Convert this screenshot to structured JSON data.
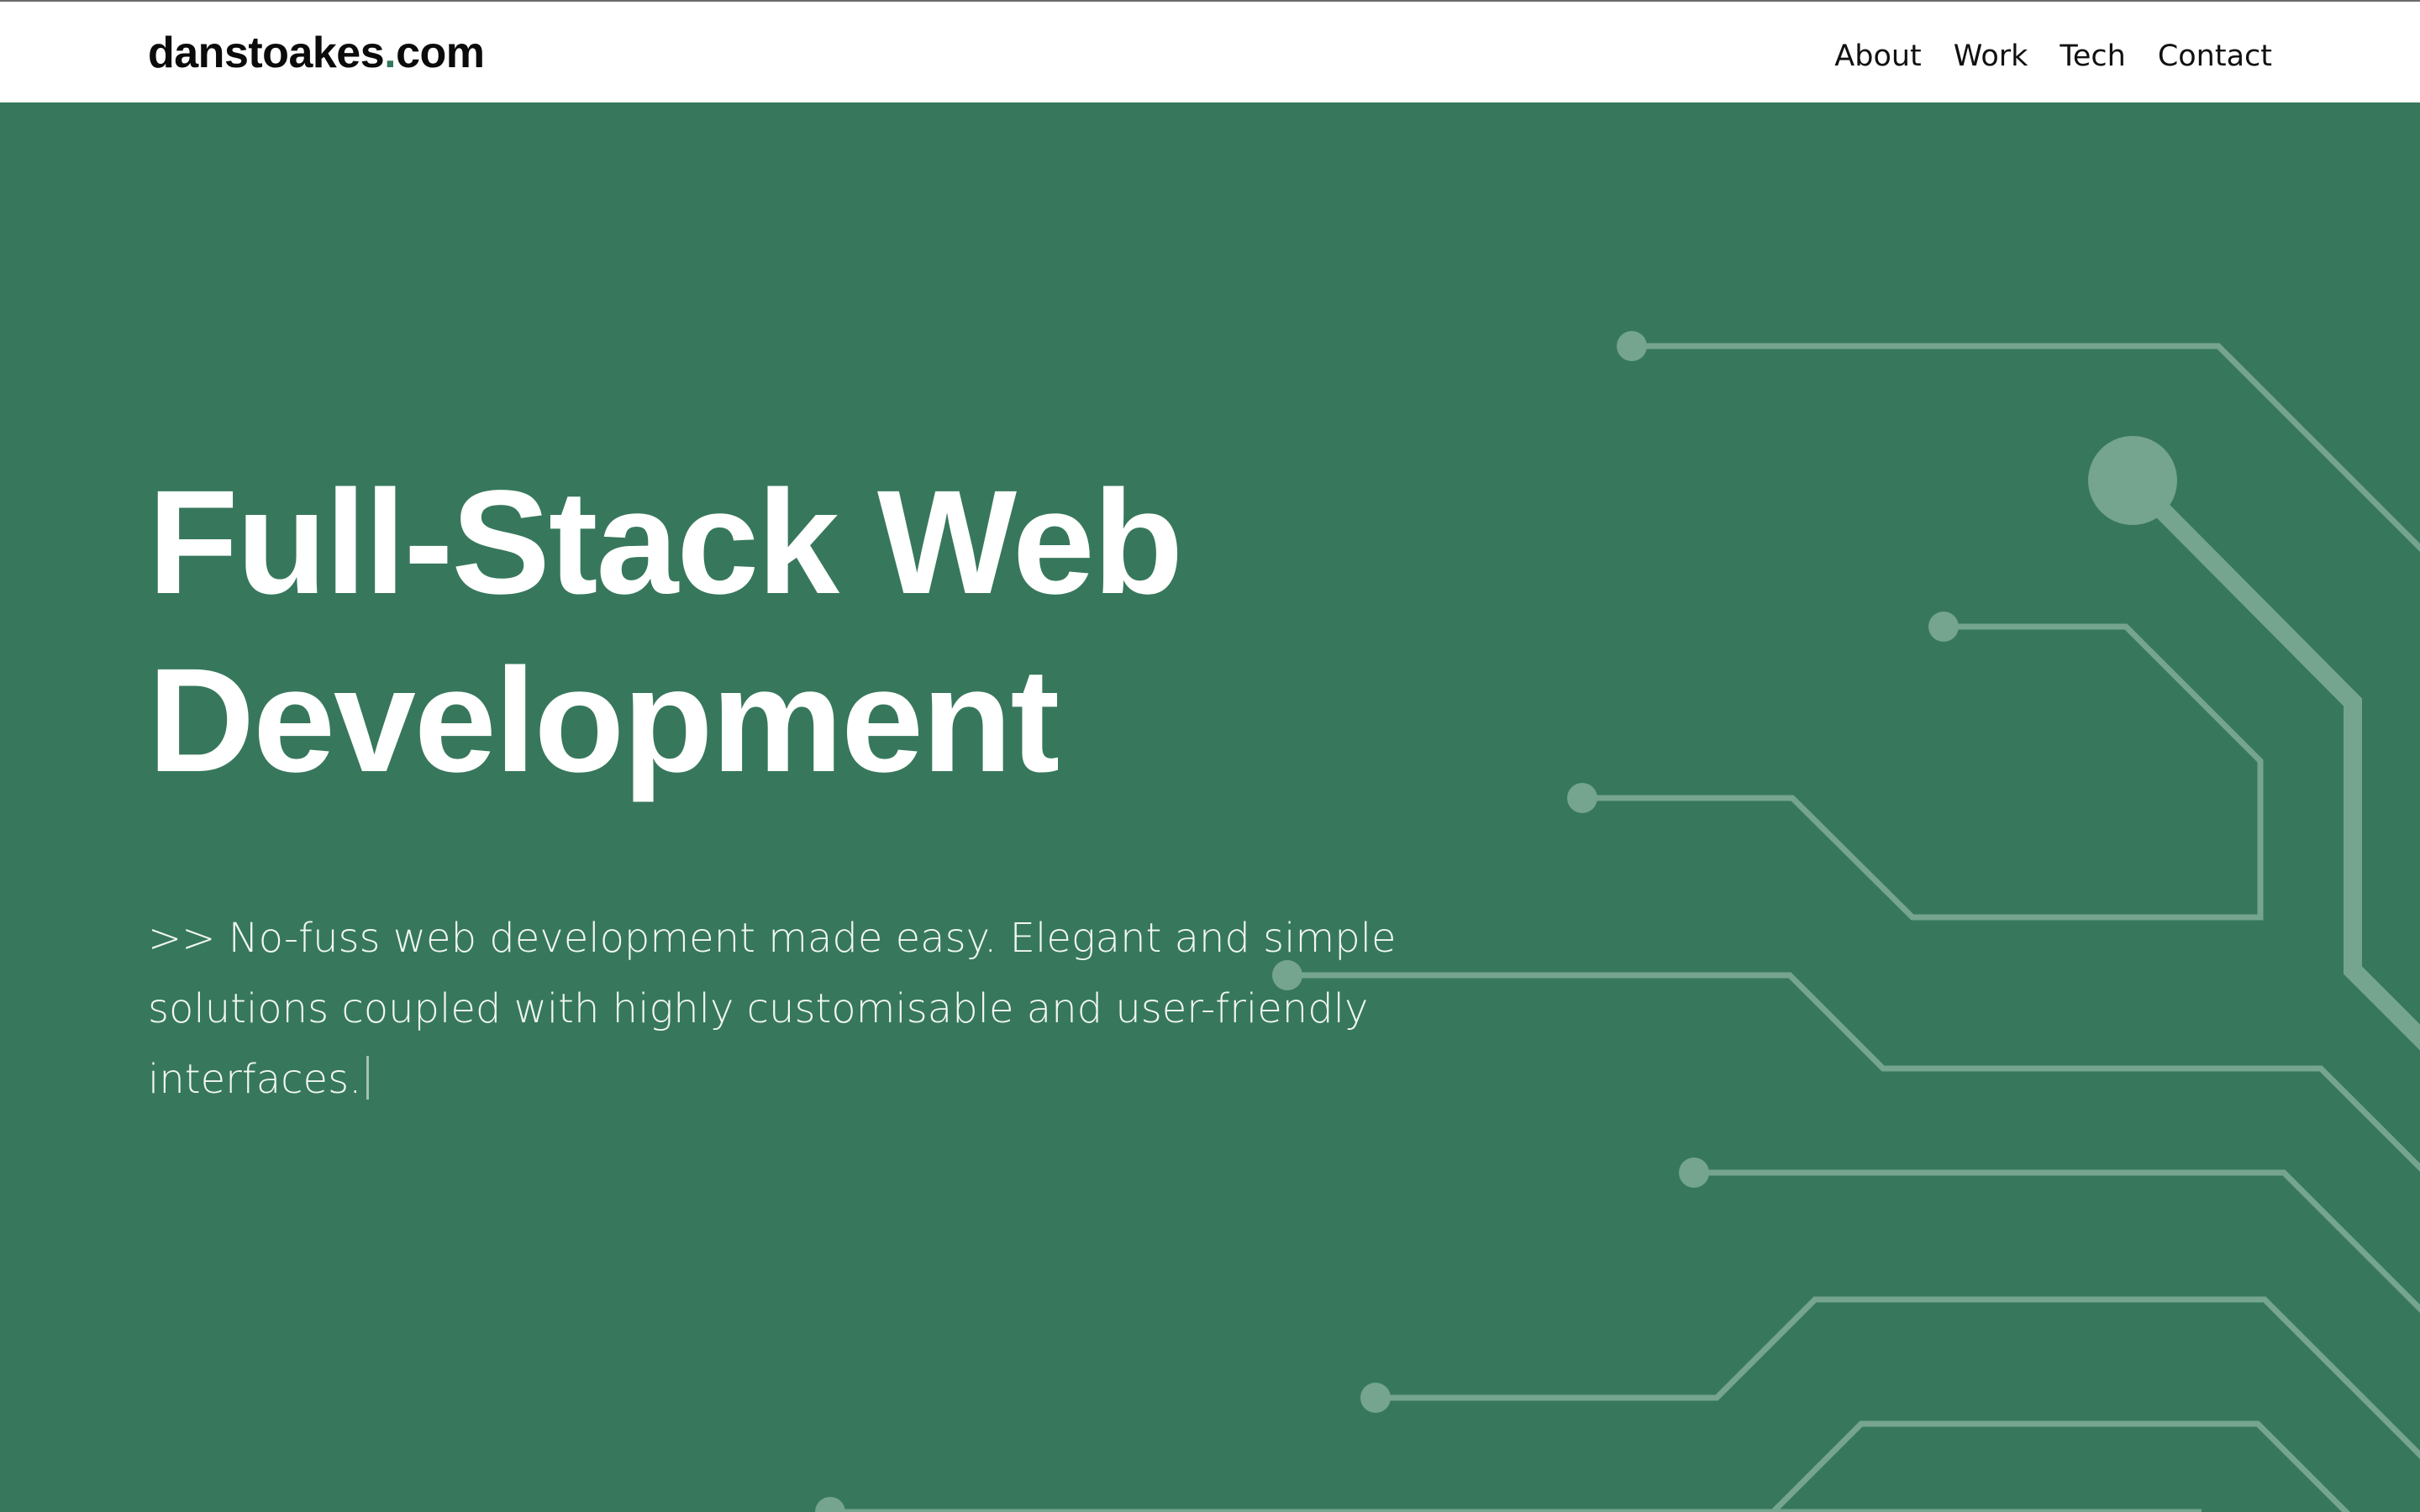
{
  "site": {
    "logo_name": "danstoakes",
    "logo_dot": ".",
    "logo_tld": "com"
  },
  "nav": {
    "items": [
      {
        "label": "About"
      },
      {
        "label": "Work"
      },
      {
        "label": "Tech"
      },
      {
        "label": "Contact"
      }
    ]
  },
  "hero": {
    "title_line1": "Full-Stack Web",
    "title_line2": "Development",
    "subtitle": ">> No-fuss web development made easy. Elegant and simple solutions coupled with highly customisable and user-friendly interfaces."
  },
  "colors": {
    "brand_green": "#37785c",
    "circuit_trace": "#75a48f",
    "navbar_bg": "#ffffff"
  },
  "icons": {
    "background_art": "circuit-traces-illustration",
    "text_cursor": "typing-caret"
  }
}
